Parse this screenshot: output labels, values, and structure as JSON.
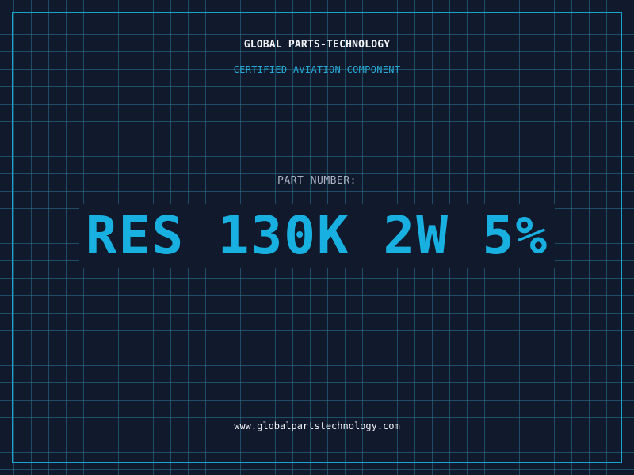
{
  "header": {
    "company": "GLOBAL PARTS-TECHNOLOGY",
    "subtitle": "CERTIFIED AVIATION COMPONENT"
  },
  "part": {
    "label": "PART NUMBER:",
    "value": "RES 130K 2W 5%"
  },
  "footer": {
    "website": "www.globalpartstechnology.com"
  },
  "colors": {
    "background": "#111a2d",
    "grid": "#26788f",
    "accent": "#18b0e0",
    "text": "#f2f4f8",
    "muted": "#a9b4c4"
  }
}
